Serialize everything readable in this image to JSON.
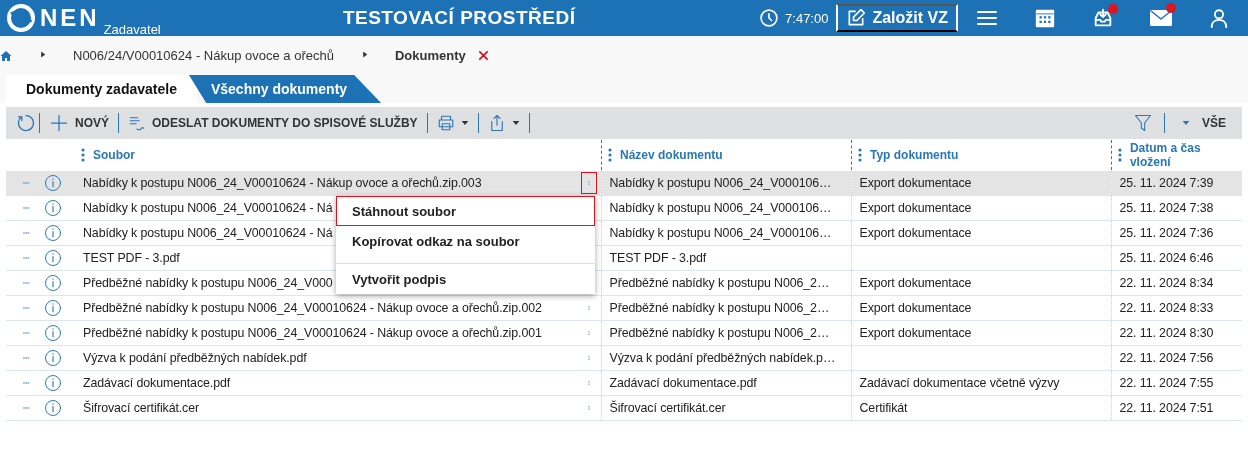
{
  "header": {
    "logo_text": "NEN",
    "logo_subtitle": "Zadavatel",
    "environment": "TESTOVACÍ PROSTŘEDÍ",
    "time": "7:47:00",
    "create_button": "Založit VZ",
    "icons": [
      {
        "kind": "menu",
        "badge": false
      },
      {
        "kind": "calendar",
        "badge": false
      },
      {
        "kind": "inbox",
        "badge": true
      },
      {
        "kind": "mail",
        "badge": true
      },
      {
        "kind": "user",
        "badge": false
      }
    ]
  },
  "breadcrumb": {
    "items": [
      "N006/24/V00010624 - Nákup ovoce a ořechů",
      "Dokumenty"
    ]
  },
  "tabs": [
    {
      "label": "Dokumenty zadavatele",
      "selected": true
    },
    {
      "label": "Všechny dokumenty",
      "selected": false
    }
  ],
  "toolbar": {
    "new": "NOVÝ",
    "send": "ODESLAT DOKUMENTY DO SPISOVÉ SLUŽBY",
    "filter_label": "VŠE"
  },
  "table": {
    "columns": [
      "Soubor",
      "Název dokumentu",
      "Typ dokumentu",
      "Datum a čas vložení"
    ],
    "rows": [
      {
        "file": "Nabídky k postupu N006_24_V00010624 - Nákup ovoce a ořechů.zip.003",
        "name": "Nabídky k postupu N006_24_V000106…",
        "type": "Export dokumentace",
        "date": "25. 11. 2024 7:39",
        "selected": true
      },
      {
        "file": "Nabídky k postupu N006_24_V00010624 - Ná",
        "name": "Nabídky k postupu N006_24_V000106…",
        "type": "Export dokumentace",
        "date": "25. 11. 2024 7:38",
        "selected": false
      },
      {
        "file": "Nabídky k postupu N006_24_V00010624 - Ná",
        "name": "Nabídky k postupu N006_24_V000106…",
        "type": "Export dokumentace",
        "date": "25. 11. 2024 7:36",
        "selected": false
      },
      {
        "file": "TEST PDF - 3.pdf",
        "name": "TEST PDF - 3.pdf",
        "date": "25. 11. 2024 6:46",
        "selected": false
      },
      {
        "file": "Předběžné nabídky k postupu N006_24_V000",
        "name": "Předběžné nabídky k postupu N006_2…",
        "type": "Export dokumentace",
        "date": "22. 11. 2024 8:34",
        "selected": false
      },
      {
        "file": "Předběžné nabídky k postupu N006_24_V00010624 - Nákup ovoce a ořechů.zip.002",
        "name": "Předběžné nabídky k postupu N006_2…",
        "type": "Export dokumentace",
        "date": "22. 11. 2024 8:33",
        "selected": false
      },
      {
        "file": "Předběžné nabídky k postupu N006_24_V00010624 - Nákup ovoce a ořechů.zip.001",
        "name": "Předběžné nabídky k postupu N006_2…",
        "type": "Export dokumentace",
        "date": "22. 11. 2024 8:30",
        "selected": false
      },
      {
        "file": "Výzva k podání předběžných nabídek.pdf",
        "name": "Výzva k podání předběžných nabídek.p…",
        "date": "22. 11. 2024 7:56",
        "selected": false
      },
      {
        "file": "Zadávací dokumentace.pdf",
        "name": "Zadávací dokumentace.pdf",
        "type": "Zadávací dokumentace včetně výzvy",
        "date": "22. 11. 2024 7:55",
        "selected": false
      },
      {
        "file": "Šifrovací certifikát.cer",
        "name": "Šifrovací certifikát.cer",
        "type": "Certifikát",
        "date": "22. 11. 2024 7:51",
        "selected": false
      }
    ]
  },
  "context_menu": {
    "items": [
      {
        "label": "Stáhnout soubor",
        "selected": true
      },
      {
        "label": "Kopírovat odkaz na soubor",
        "selected": false
      },
      {
        "label": "Vytvořit podpis",
        "selected": false
      }
    ]
  }
}
